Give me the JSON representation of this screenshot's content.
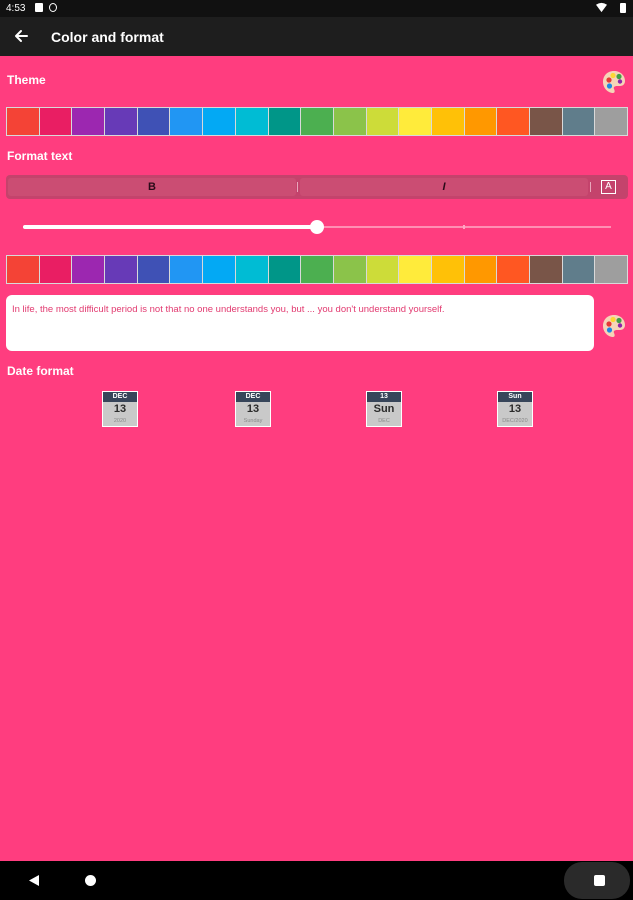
{
  "status_bar": {
    "time": "4:53"
  },
  "app_bar": {
    "title": "Color and format",
    "back_icon": "arrow-left-icon"
  },
  "theme": {
    "label": "Theme",
    "palette_icon": "palette-icon",
    "colors": [
      "#f44336",
      "#e91e63",
      "#9c27b0",
      "#673ab7",
      "#3f51b5",
      "#2196f3",
      "#03a9f4",
      "#00bcd4",
      "#009688",
      "#4caf50",
      "#8bc34a",
      "#cddc39",
      "#ffeb3b",
      "#ffc107",
      "#ff9800",
      "#ff5722",
      "#795548",
      "#607d8b",
      "#9e9e9e"
    ]
  },
  "format_text": {
    "label": "Format text",
    "bold_label": "B",
    "italic_label": "I",
    "text_color_label": "A",
    "text_size_value": 0.5,
    "colors": [
      "#f44336",
      "#e91e63",
      "#9c27b0",
      "#673ab7",
      "#3f51b5",
      "#2196f3",
      "#03a9f4",
      "#00bcd4",
      "#009688",
      "#4caf50",
      "#8bc34a",
      "#cddc39",
      "#ffeb3b",
      "#ffc107",
      "#ff9800",
      "#ff5722",
      "#795548",
      "#607d8b",
      "#9e9e9e"
    ],
    "preview_text": "In life, the most difficult period is not that no one understands you, but ... you don't understand yourself.",
    "palette_icon": "palette-icon"
  },
  "date_format": {
    "label": "Date format",
    "options": [
      {
        "top": "DEC",
        "main": "13",
        "sub": "2020"
      },
      {
        "top": "DEC",
        "main": "13",
        "sub": "Sunday"
      },
      {
        "top": "13",
        "main": "Sun",
        "sub": "DEC"
      },
      {
        "top": "Sun",
        "main": "13",
        "sub": "DEC/2020"
      }
    ]
  },
  "colors": {
    "background": "#ff3d7f",
    "app_bar": "#1e1e1e",
    "accent_text": "#e23a70"
  }
}
